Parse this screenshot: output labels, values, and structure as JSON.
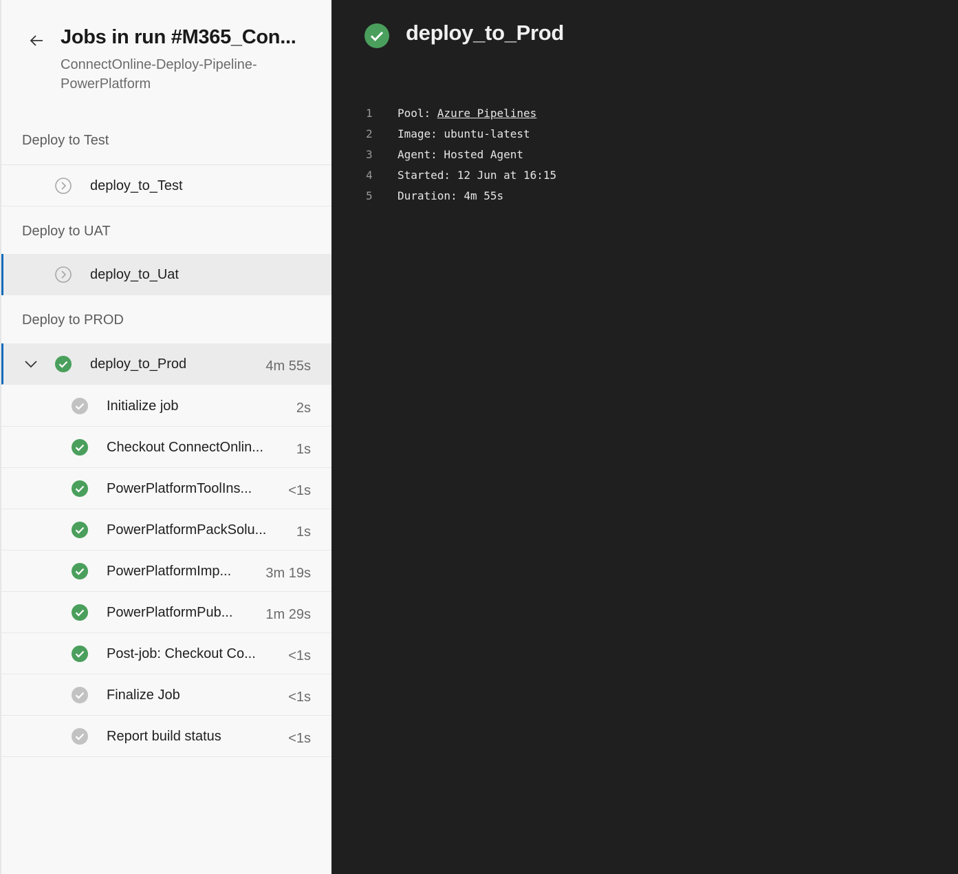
{
  "header": {
    "title": "Jobs in run #M365_Con...",
    "subtitle": "ConnectOnline-Deploy-Pipeline-PowerPlatform"
  },
  "stages": [
    {
      "name": "Deploy to Test",
      "jobs": [
        {
          "name": "deploy_to_Test",
          "status": "pending",
          "duration": ""
        }
      ]
    },
    {
      "name": "Deploy to UAT",
      "jobs": [
        {
          "name": "deploy_to_Uat",
          "status": "pending",
          "duration": ""
        }
      ]
    },
    {
      "name": "Deploy to PROD",
      "jobs": [
        {
          "name": "deploy_to_Prod",
          "status": "succeeded",
          "duration": "4m 55s",
          "expanded": true,
          "steps": [
            {
              "name": "Initialize job",
              "status": "skipped",
              "duration": "2s"
            },
            {
              "name": "Checkout ConnectOnlin...",
              "status": "succeeded",
              "duration": "1s"
            },
            {
              "name": "PowerPlatformToolIns...",
              "status": "succeeded",
              "duration": "<1s"
            },
            {
              "name": "PowerPlatformPackSolu...",
              "status": "succeeded",
              "duration": "1s"
            },
            {
              "name": "PowerPlatformImp...",
              "status": "succeeded",
              "duration": "3m 19s"
            },
            {
              "name": "PowerPlatformPub...",
              "status": "succeeded",
              "duration": "1m 29s"
            },
            {
              "name": "Post-job: Checkout Co...",
              "status": "succeeded",
              "duration": "<1s"
            },
            {
              "name": "Finalize Job",
              "status": "skipped",
              "duration": "<1s"
            },
            {
              "name": "Report build status",
              "status": "skipped",
              "duration": "<1s"
            }
          ]
        }
      ]
    }
  ],
  "detail": {
    "title": "deploy_to_Prod",
    "status": "succeeded",
    "log": [
      {
        "num": "1",
        "label": "Pool: ",
        "link": "Azure Pipelines"
      },
      {
        "num": "2",
        "label": "Image: ubuntu-latest"
      },
      {
        "num": "3",
        "label": "Agent: Hosted Agent"
      },
      {
        "num": "4",
        "label": "Started: 12 Jun at 16:15"
      },
      {
        "num": "5",
        "label": "Duration: 4m 55s"
      }
    ]
  },
  "colors": {
    "success": "#4a9f5c",
    "neutral": "#c2c2c2",
    "accent": "#0f6cbd",
    "pending": "#a6a6a6"
  },
  "icons": {
    "back": "arrow-left-icon",
    "pending": "circle-chevron-icon",
    "success": "check-circle-icon",
    "skipped": "gray-check-circle-icon",
    "expand": "chevron-down-icon"
  }
}
